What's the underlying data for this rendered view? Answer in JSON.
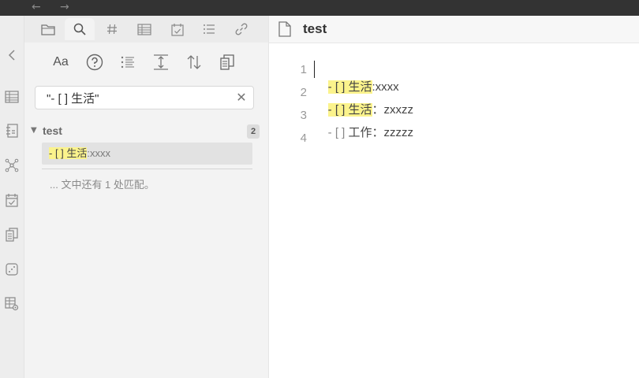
{
  "titlebar": {
    "back_glyph": "←",
    "forward_glyph": "→"
  },
  "rail": {
    "icons": [
      "collapse-left-icon",
      "table-icon",
      "outline-icon",
      "graph-icon",
      "calendar-check-icon",
      "copy-icon",
      "dice-icon",
      "table-settings-icon"
    ]
  },
  "sidebar": {
    "tabs": [
      "folder-icon",
      "search-icon",
      "hashtag-icon",
      "table-icon",
      "calendar-check-icon",
      "list-icon",
      "link-icon"
    ],
    "active_tab": "search-icon",
    "tools": {
      "match_case_label": "Aa",
      "icons": [
        "match-case-icon",
        "help-icon",
        "list-icon",
        "expand-vertical-icon",
        "sort-icon",
        "copy-icon"
      ]
    },
    "search": {
      "value": "\"- [ ] 生活\"",
      "clear_glyph": "✕"
    },
    "results": {
      "group_title": "test",
      "group_caret": "▼",
      "count": "2",
      "match_highlight": "- [ ] 生活",
      "match_rest": ":xxxx",
      "more_note": "... 文中还有 1 处匹配。"
    }
  },
  "editor": {
    "title": "test",
    "line_numbers": [
      "1",
      "2",
      "3",
      "4"
    ],
    "lines": [
      {
        "highlight": "- [ ] 生活",
        "rest": ":xxxx"
      },
      {
        "highlight": "- [ ] 生活",
        "rest": "：zxxzz"
      },
      {
        "marker": "- [ ]",
        "rest": " 工作：zzzzz"
      }
    ]
  },
  "colors": {
    "highlight": "#fbf38c",
    "titlebar": "#333333",
    "sidebar_bg": "#f3f3f3",
    "rail_bg": "#ededed"
  }
}
